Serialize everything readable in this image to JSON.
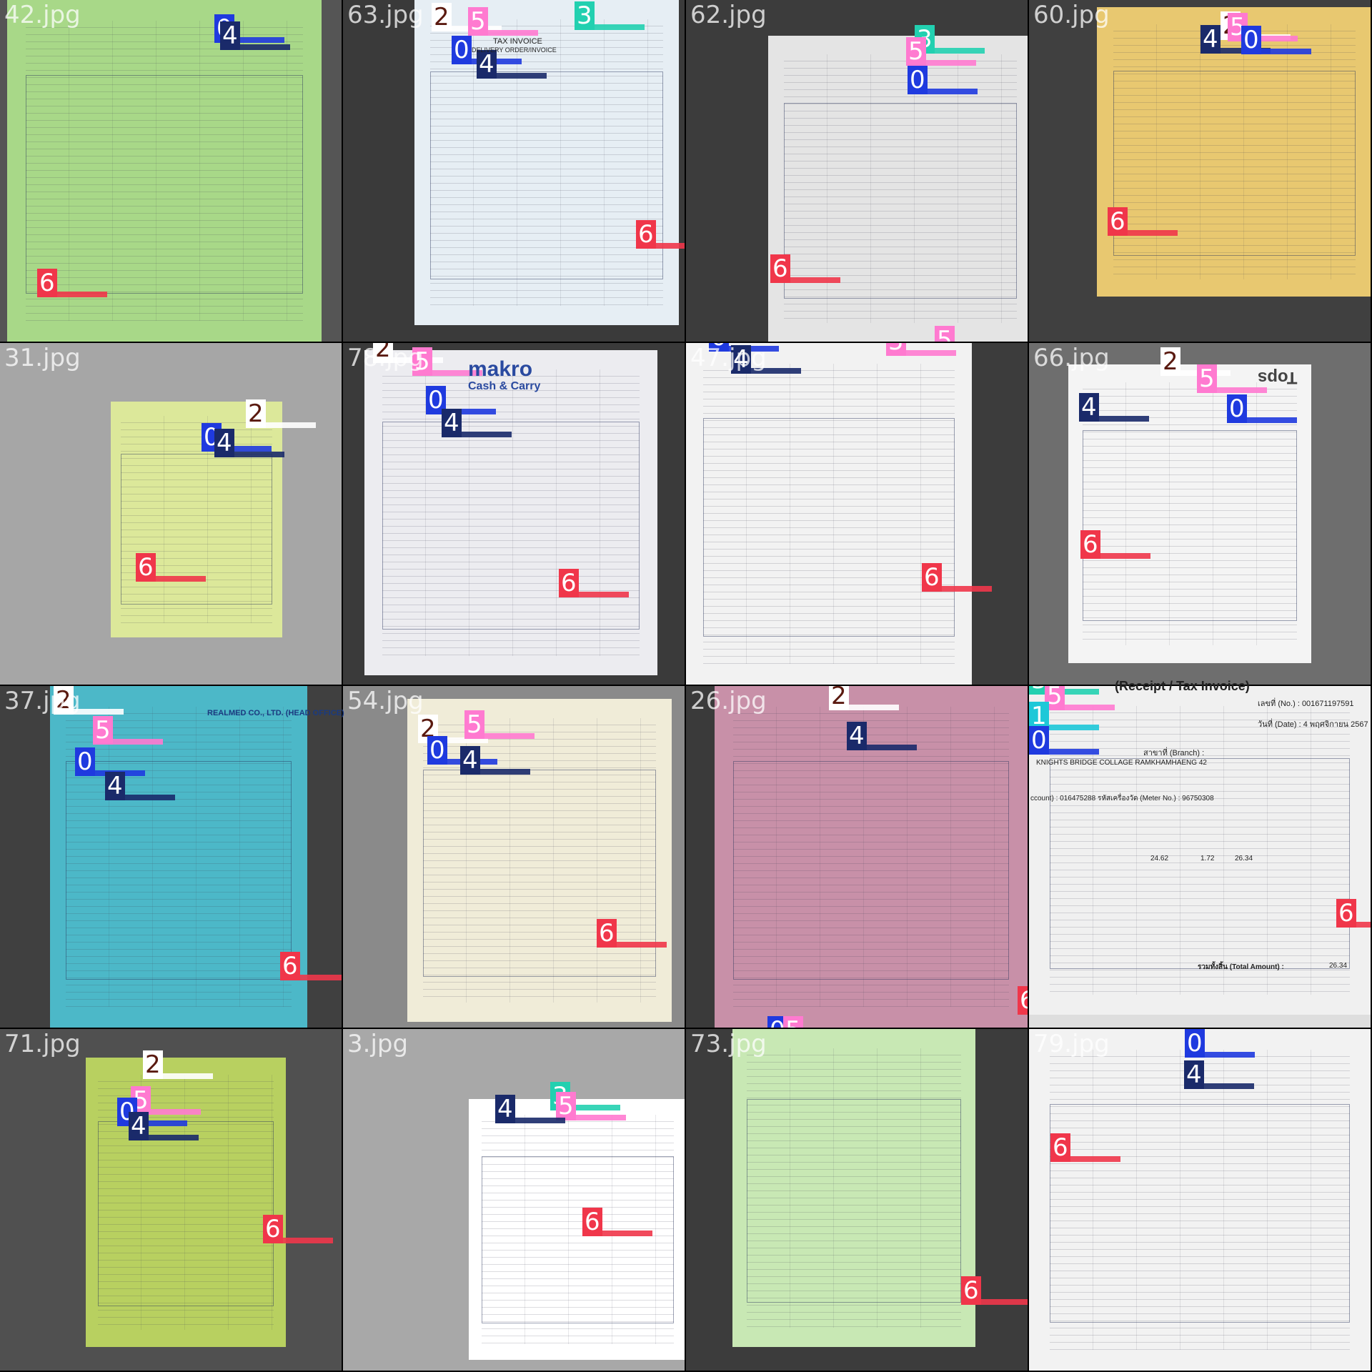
{
  "class_colors": {
    "0": "#1f3adf",
    "1": "#1ec8d8",
    "2": "#ffffff",
    "3": "#22d0b0",
    "4": "#1a2a6a",
    "5": "#ff7ad0",
    "6": "#f0364a"
  },
  "class_text_colors": {
    "0": "#ffffff",
    "1": "#ffffff",
    "2": "#5a1a10",
    "3": "#ffffff",
    "4": "#ffffff",
    "5": "#ffffff",
    "6": "#ffffff"
  },
  "tiles": [
    {
      "filename": "42.jpg",
      "bg": "#555555",
      "paper": "#a8d888",
      "labels": [
        "0",
        "4",
        "6"
      ]
    },
    {
      "filename": "63.jpg",
      "bg": "#3a3a3a",
      "paper": "#e6eef4",
      "labels": [
        "2",
        "5",
        "3",
        "0",
        "4",
        "6"
      ]
    },
    {
      "filename": "62.jpg",
      "bg": "#3c3c3c",
      "paper": "#e4e4e4",
      "labels": [
        "3",
        "5",
        "0",
        "6",
        "5"
      ]
    },
    {
      "filename": "60.jpg",
      "bg": "#404040",
      "paper": "#e8c870",
      "labels": [
        "4",
        "2",
        "5",
        "0",
        "6"
      ]
    },
    {
      "filename": "31.jpg",
      "bg": "#a6a6a6",
      "paper": "#dce89a",
      "labels": [
        "2",
        "0",
        "4",
        "6"
      ]
    },
    {
      "filename": "78.jpg",
      "bg": "#3a3a3a",
      "paper": "#ececf0",
      "labels": [
        "2",
        "5",
        "0",
        "4",
        "6"
      ]
    },
    {
      "filename": "47.jpg",
      "bg": "#3c3c3c",
      "paper": "#f2f2f2",
      "labels": [
        "0",
        "4",
        "5",
        "6"
      ]
    },
    {
      "filename": "66.jpg",
      "bg": "#6e6e6e",
      "paper": "#f4f4f4",
      "labels": [
        "2",
        "5",
        "4",
        "0",
        "6"
      ]
    },
    {
      "filename": "37.jpg",
      "bg": "#404040",
      "paper": "#4cb8c8",
      "labels": [
        "2",
        "5",
        "0",
        "4",
        "6"
      ]
    },
    {
      "filename": "54.jpg",
      "bg": "#8a8a8a",
      "paper": "#f0ecd8",
      "labels": [
        "2",
        "5",
        "0",
        "4",
        "6"
      ]
    },
    {
      "filename": "26.jpg",
      "bg": "#3a3a3a",
      "paper": "#c890a8",
      "labels": [
        "2",
        "4",
        "0",
        "5",
        "6"
      ]
    },
    {
      "filename": "",
      "bg": "#dedede",
      "paper": "#f0f0f0",
      "labels": [
        "3",
        "5",
        "1",
        "0",
        "6"
      ]
    },
    {
      "filename": "71.jpg",
      "bg": "#505050",
      "paper": "#b8d060",
      "labels": [
        "2",
        "5",
        "0",
        "4",
        "6"
      ]
    },
    {
      "filename": "3.jpg",
      "bg": "#a8a8a8",
      "paper": "#ffffff",
      "labels": [
        "3",
        "5",
        "4",
        "6"
      ]
    },
    {
      "filename": "73.jpg",
      "bg": "#3c3c3c",
      "paper": "#c8e8b4",
      "labels": [
        "6"
      ]
    },
    {
      "filename": "79.jpg",
      "bg": "#5a5a5a",
      "paper": "#f2f2f2",
      "labels": [
        "0",
        "4",
        "6"
      ]
    }
  ],
  "visible_text": {
    "makro_logo": "makro",
    "makro_sub": "Cash & Carry",
    "tops_logo": "Tops",
    "receipt_header": "(Receipt / Tax Invoice)",
    "bm_invoice": "TAX INVOICE",
    "bm_delivery": "DELIVERY ORDER/INVOICE",
    "bm_company": "REALMED CO., LTD. (HEAD OFFICE)",
    "receipt_no": "เลขที่ (No.) : 001671197591",
    "receipt_date": "วันที่ (Date) : 4 พฤศจิกายน 2567",
    "receipt_branch": "สาขาที่ (Branch) :",
    "receipt_addr": "KNIGHTS BRIDGE COLLAGE RAMKHAMHAENG 42",
    "receipt_meter": "ccount) : 016475288   รหัสเครื่องวัด (Meter No.) : 96750308",
    "receipt_amount": "26.34",
    "receipt_vat": "1.72",
    "receipt_elec": "24.62",
    "receipt_total_label": "รวมทั้งสิ้น (Total Amount) :",
    "receipt_total": "26.34"
  }
}
